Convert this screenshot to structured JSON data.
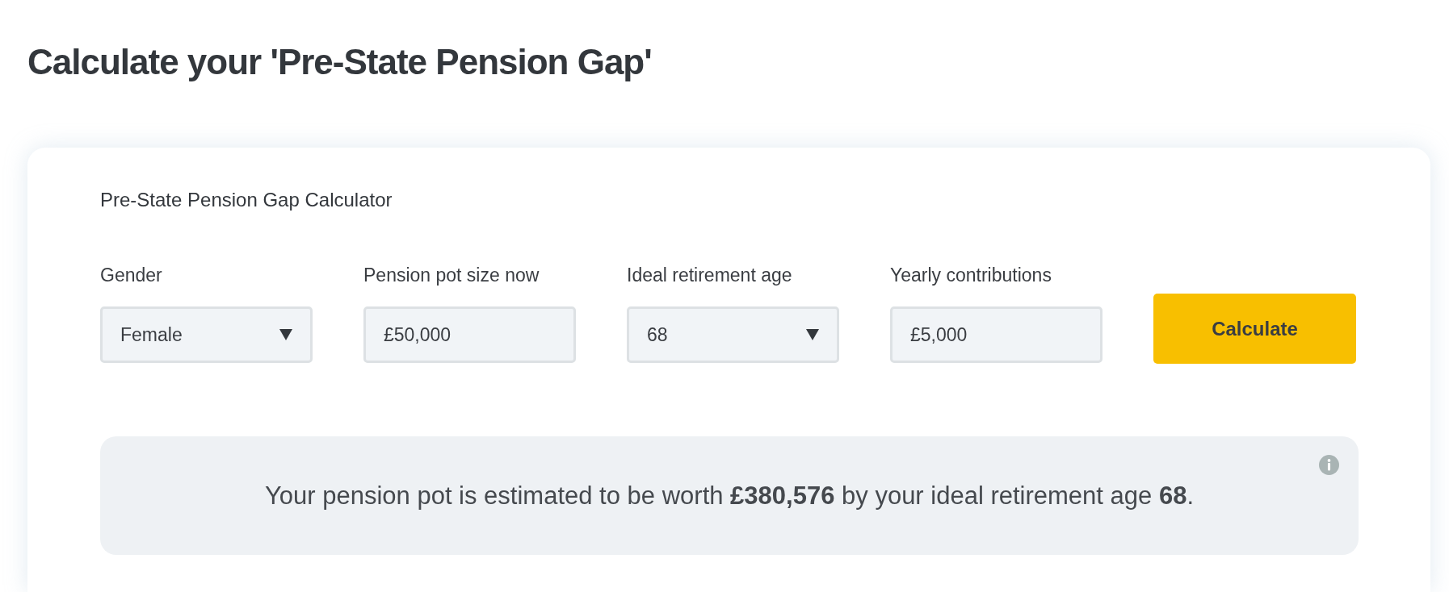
{
  "page": {
    "title": "Calculate your 'Pre-State Pension Gap'"
  },
  "calculator": {
    "title": "Pre-State Pension Gap Calculator",
    "fields": [
      {
        "kind": "select",
        "label": "Gender",
        "value": "Female"
      },
      {
        "kind": "input",
        "label": "Pension pot size now",
        "value": "£50,000"
      },
      {
        "kind": "select",
        "label": "Ideal retirement age",
        "value": "68"
      },
      {
        "kind": "input",
        "label": "Yearly contributions",
        "value": "£5,000"
      }
    ],
    "button": "Calculate",
    "result": {
      "text": "Your pension pot is estimated to be worth **£380,576** by your ideal retirement age **68**."
    }
  }
}
